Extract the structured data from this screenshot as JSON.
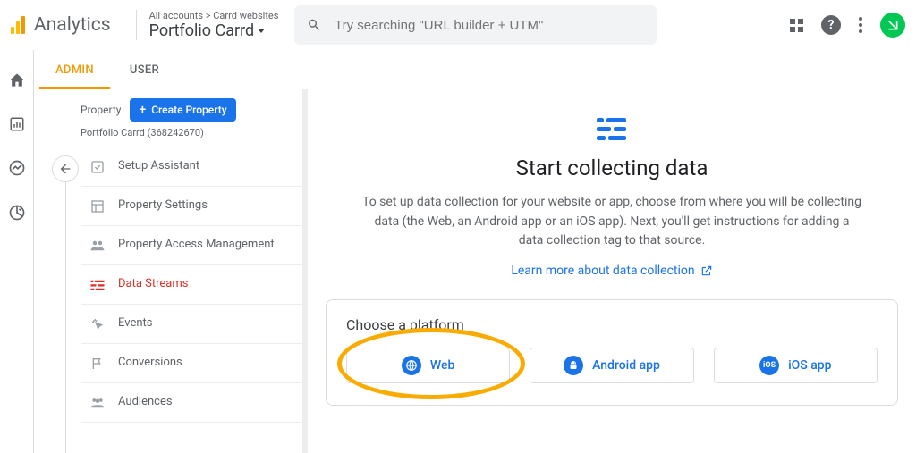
{
  "header": {
    "product": "Analytics",
    "breadcrumb_prefix": "All accounts",
    "breadcrumb_sep": ">",
    "breadcrumb_account": "Carrd websites",
    "account_title": "Portfolio Carrd",
    "search_placeholder": "Try searching \"URL builder + UTM\""
  },
  "tabs": {
    "admin": "ADMIN",
    "user": "USER"
  },
  "settings": {
    "section_label": "Property",
    "create_btn": "Create Property",
    "property_name": "Portfolio Carrd (368242670)",
    "items": [
      {
        "label": "Setup Assistant"
      },
      {
        "label": "Property Settings"
      },
      {
        "label": "Property Access Management"
      },
      {
        "label": "Data Streams"
      },
      {
        "label": "Events"
      },
      {
        "label": "Conversions"
      },
      {
        "label": "Audiences"
      }
    ]
  },
  "main": {
    "title": "Start collecting data",
    "desc": "To set up data collection for your website or app, choose from where you will be collecting data (the Web, an Android app or an iOS app). Next, you'll get instructions for adding a data collection tag to that source.",
    "learn_more": "Learn more about data collection",
    "card_title": "Choose a platform",
    "platforms": {
      "web": "Web",
      "android": "Android app",
      "ios": "iOS app",
      "ios_badge": "iOS"
    }
  }
}
